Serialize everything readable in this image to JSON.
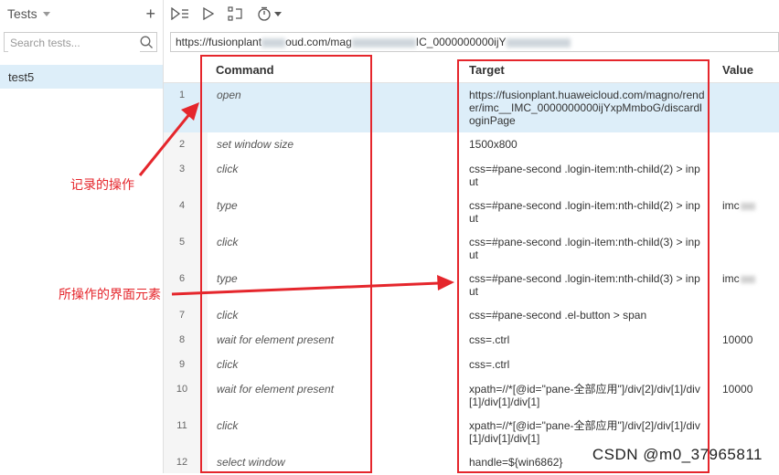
{
  "sidebar": {
    "title": "Tests",
    "search_placeholder": "Search tests...",
    "tests": [
      "test5"
    ]
  },
  "url": {
    "part1": "https://fusionplant",
    "part2": "oud.com/mag",
    "part3": "IC_0000000000ijY"
  },
  "table": {
    "headers": {
      "command": "Command",
      "target": "Target",
      "value": "Value"
    },
    "rows": [
      {
        "index": "1",
        "command": "open",
        "target": "https://fusionplant.huaweicloud.com/magno/render/imc__IMC_0000000000ijYxpMmboG/discardloginPage",
        "value": ""
      },
      {
        "index": "2",
        "command": "set window size",
        "target": "1500x800",
        "value": ""
      },
      {
        "index": "3",
        "command": "click",
        "target": "css=#pane-second .login-item:nth-child(2) > input",
        "value": ""
      },
      {
        "index": "4",
        "command": "type",
        "target": "css=#pane-second .login-item:nth-child(2) > input",
        "value": "imc"
      },
      {
        "index": "5",
        "command": "click",
        "target": "css=#pane-second .login-item:nth-child(3) > input",
        "value": ""
      },
      {
        "index": "6",
        "command": "type",
        "target": "css=#pane-second .login-item:nth-child(3) > input",
        "value": "imc"
      },
      {
        "index": "7",
        "command": "click",
        "target": "css=#pane-second .el-button > span",
        "value": ""
      },
      {
        "index": "8",
        "command": "wait for element present",
        "target": "css=.ctrl",
        "value": "10000"
      },
      {
        "index": "9",
        "command": "click",
        "target": "css=.ctrl",
        "value": ""
      },
      {
        "index": "10",
        "command": "wait for element present",
        "target": "xpath=//*[@id=\"pane-全部应用\"]/div[2]/div[1]/div[1]/div[1]/div[1]",
        "value": "10000"
      },
      {
        "index": "11",
        "command": "click",
        "target": "xpath=//*[@id=\"pane-全部应用\"]/div[2]/div[1]/div[1]/div[1]/div[1]",
        "value": ""
      },
      {
        "index": "12",
        "command": "select window",
        "target": "handle=${win6862}",
        "value": ""
      }
    ]
  },
  "annotations": {
    "recorded_ops": "记录的操作",
    "target_elements": "所操作的界面元素"
  },
  "watermark": "CSDN @m0_37965811",
  "colors": {
    "annotation_red": "#e5262c",
    "selection_blue": "#ddeef9"
  }
}
